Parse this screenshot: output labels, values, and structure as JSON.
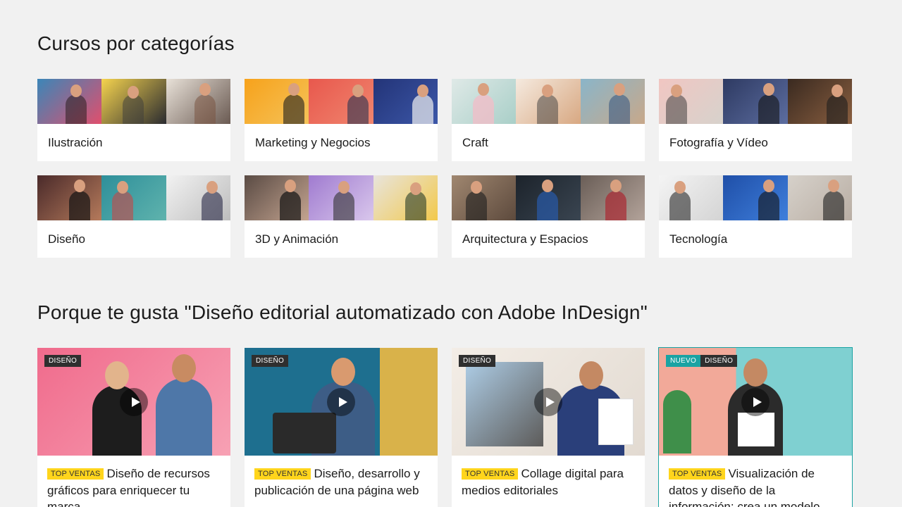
{
  "sections": {
    "categories_title": "Cursos por categorías",
    "recommend_title": "Porque te gusta \"Diseño editorial automatizado con Adobe InDesign\""
  },
  "categories": [
    {
      "label": "Ilustración",
      "colors": [
        "#4a89b6",
        "#2b2e38",
        "#e8e1d8"
      ]
    },
    {
      "label": "Marketing y Negocios",
      "colors": [
        "#f7a21b",
        "#e8584d",
        "#2f3f7f"
      ]
    },
    {
      "label": "Craft",
      "colors": [
        "#cfe3e3",
        "#f2e6d9",
        "#8ab5c9"
      ]
    },
    {
      "label": "Fotografía y Vídeo",
      "colors": [
        "#f1c6c2",
        "#3c4970",
        "#5a4233"
      ]
    },
    {
      "label": "Diseño",
      "colors": [
        "#7b4a3c",
        "#2e8f9a",
        "#d8d8d8"
      ]
    },
    {
      "label": "3D y Animación",
      "colors": [
        "#7a6c64",
        "#a07bd0",
        "#e8e4dc"
      ]
    },
    {
      "label": "Arquitectura y Espacios",
      "colors": [
        "#8b6f5b",
        "#222a33",
        "#a08f86"
      ]
    },
    {
      "label": "Tecnología",
      "colors": [
        "#e9e9e9",
        "#1f4fa8",
        "#d6d1ca"
      ]
    }
  ],
  "courses": [
    {
      "category_badge": "DISEÑO",
      "new_badge": "",
      "tag": "TOP VENTAS",
      "title": "Diseño de recursos gráficos para enriquecer tu marca",
      "colors": [
        "#f06b8c",
        "#f5b3c2"
      ]
    },
    {
      "category_badge": "DISEÑO",
      "new_badge": "",
      "tag": "TOP VENTAS",
      "title": "Diseño, desarrollo y publicación de una página web",
      "colors": [
        "#1e6f8f",
        "#d9b24a"
      ]
    },
    {
      "category_badge": "DISEÑO",
      "new_badge": "",
      "tag": "TOP VENTAS",
      "title": "Collage digital para medios editoriales",
      "colors": [
        "#f3ede6",
        "#e9e2da"
      ]
    },
    {
      "category_badge": "DISEÑO",
      "new_badge": "NUEVO",
      "tag": "TOP VENTAS",
      "title": "Visualización de datos y diseño de la información: crea un modelo",
      "colors": [
        "#f2a999",
        "#7fd0d1"
      ]
    }
  ],
  "icons": {
    "play": "play-icon"
  }
}
